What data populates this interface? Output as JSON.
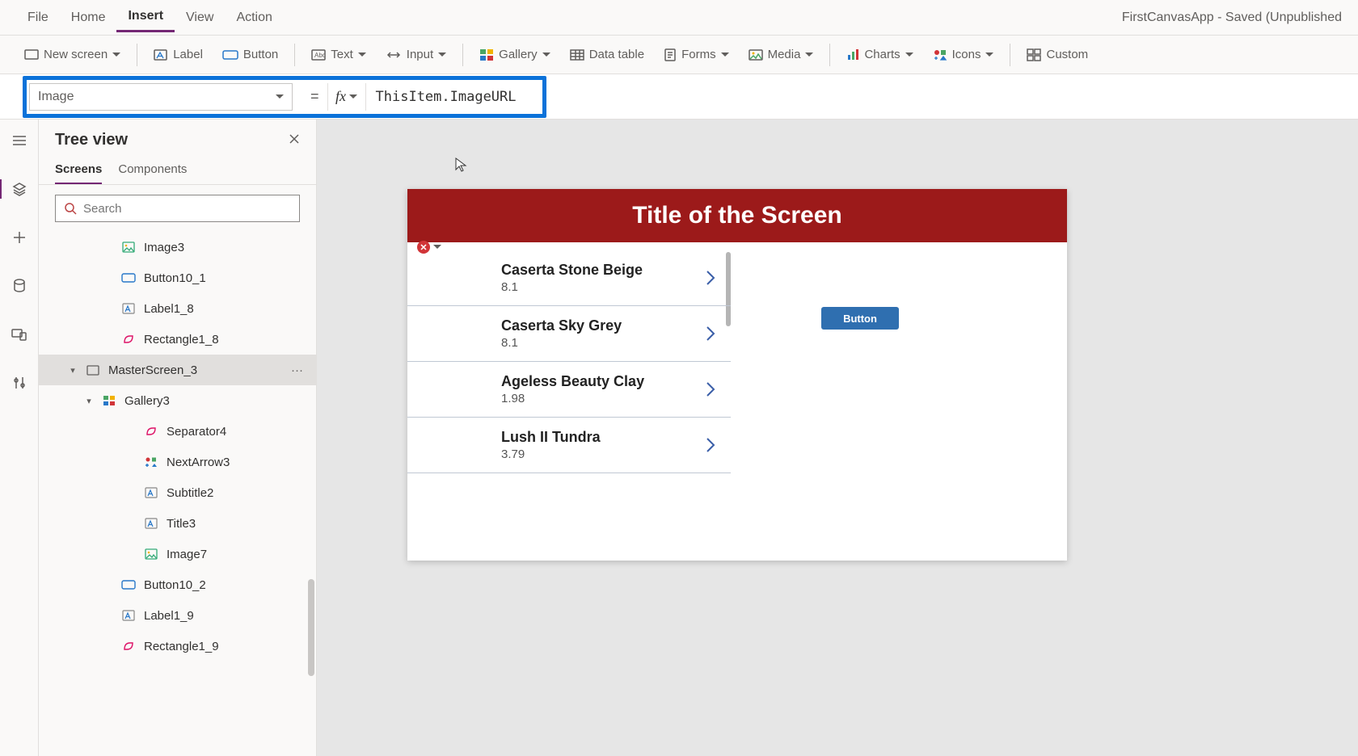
{
  "app_title": "FirstCanvasApp - Saved (Unpublished",
  "menu": {
    "file": "File",
    "home": "Home",
    "insert": "Insert",
    "view": "View",
    "action": "Action"
  },
  "ribbon": {
    "new_screen": "New screen",
    "label": "Label",
    "button": "Button",
    "text": "Text",
    "input": "Input",
    "gallery": "Gallery",
    "data_table": "Data table",
    "forms": "Forms",
    "media": "Media",
    "charts": "Charts",
    "icons": "Icons",
    "custom": "Custom"
  },
  "formula": {
    "property": "Image",
    "equals": "=",
    "fx": "fx",
    "value": "ThisItem.ImageURL"
  },
  "tree": {
    "title": "Tree view",
    "tab_screens": "Screens",
    "tab_components": "Components",
    "search_placeholder": "Search",
    "nodes": [
      {
        "label": "Image3",
        "indent": 3,
        "icon": "image",
        "caret": ""
      },
      {
        "label": "Button10_1",
        "indent": 3,
        "icon": "button",
        "caret": ""
      },
      {
        "label": "Label1_8",
        "indent": 3,
        "icon": "label",
        "caret": ""
      },
      {
        "label": "Rectangle1_8",
        "indent": 3,
        "icon": "shape",
        "caret": ""
      },
      {
        "label": "MasterScreen_3",
        "indent": 1,
        "icon": "screen",
        "caret": "open",
        "selected": true,
        "more": "···"
      },
      {
        "label": "Gallery3",
        "indent": 2,
        "icon": "gallery",
        "caret": "open"
      },
      {
        "label": "Separator4",
        "indent": 4,
        "icon": "shape",
        "caret": ""
      },
      {
        "label": "NextArrow3",
        "indent": 4,
        "icon": "icons",
        "caret": ""
      },
      {
        "label": "Subtitle2",
        "indent": 4,
        "icon": "label",
        "caret": ""
      },
      {
        "label": "Title3",
        "indent": 4,
        "icon": "label",
        "caret": ""
      },
      {
        "label": "Image7",
        "indent": 4,
        "icon": "image",
        "caret": ""
      },
      {
        "label": "Button10_2",
        "indent": 3,
        "icon": "button",
        "caret": ""
      },
      {
        "label": "Label1_9",
        "indent": 3,
        "icon": "label",
        "caret": ""
      },
      {
        "label": "Rectangle1_9",
        "indent": 3,
        "icon": "shape",
        "caret": ""
      }
    ]
  },
  "canvas": {
    "screen_title": "Title of the Screen",
    "button_label": "Button",
    "gallery_items": [
      {
        "title": "Caserta Stone Beige",
        "subtitle": "8.1"
      },
      {
        "title": "Caserta Sky Grey",
        "subtitle": "8.1"
      },
      {
        "title": "Ageless Beauty Clay",
        "subtitle": "1.98"
      },
      {
        "title": "Lush II Tundra",
        "subtitle": "3.79"
      }
    ]
  }
}
